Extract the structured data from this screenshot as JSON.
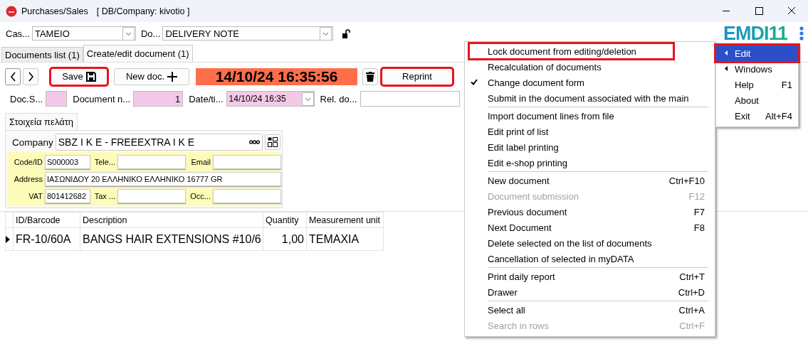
{
  "window": {
    "title": "Purchases/Sales",
    "subtitle": "[ DB/Company: kivotio ]"
  },
  "header": {
    "fields": [
      {
        "label": "Cas...",
        "value": "TAMEIO"
      },
      {
        "label": "Do...",
        "value": "DELIVERY NOTE"
      }
    ],
    "logo": "EMDI11"
  },
  "tabs": [
    {
      "label": "Documents list (1)",
      "selected": false
    },
    {
      "label": "Create/edit document (1)",
      "selected": true
    }
  ],
  "toolbar": {
    "save_button": {
      "label": "Save",
      "highlighted": true
    },
    "new_button": {
      "label": "New doc."
    },
    "clock": "14/10/24 16:35:56",
    "reprint_button": {
      "label": "Reprint",
      "highlighted": true
    }
  },
  "document_fields": [
    {
      "label": "Doc.S...",
      "kind": "field",
      "required": true
    },
    {
      "label": "Document n...",
      "value": "1",
      "kind": "field",
      "required": true
    },
    {
      "label": "Date/ti...",
      "value": "14/10/24 16:35",
      "kind": "combo",
      "required": true
    },
    {
      "label": "Rel. do...",
      "kind": "field",
      "required": false
    }
  ],
  "customer": {
    "tab": "Στοιχεία πελάτη",
    "company_label": "Company",
    "company": "SBZ I K E - FREEEXTRA I K E",
    "rows": [
      [
        {
          "label": "Code/ID",
          "value": "S000003"
        },
        {
          "label": "Tele..."
        },
        {
          "label": "Email"
        }
      ],
      [
        {
          "label": "Address",
          "value": "ΙΑΣΩΝΙΔΟΥ 20 ΕΛΛΗΝΙΚΟ ΕΛΛΗΝΙΚΟ 16777 GR"
        }
      ],
      [
        {
          "label": "VAT",
          "value": "801412682"
        },
        {
          "label": "Tax ..."
        },
        {
          "label": "Occ..."
        }
      ]
    ]
  },
  "table": {
    "columns": [
      "ID/Barcode",
      "Description",
      "Quantity",
      "Measurement unit"
    ],
    "rows": [
      {
        "current": true,
        "cells": [
          "FR-10/60A",
          "BANGS HAIR EXTENSIONS #10/6",
          "1,00",
          "TEMAXIA"
        ]
      }
    ]
  },
  "context_menu": [
    {
      "kind": "item",
      "label": "Lock document from editing/deletion",
      "checked": false,
      "disabled": false,
      "highlighted": true
    },
    {
      "kind": "item",
      "label": "Recalculation of documents",
      "checked": false,
      "disabled": false,
      "highlighted": false
    },
    {
      "kind": "item",
      "label": "Change document form",
      "checked": true,
      "disabled": false,
      "highlighted": false
    },
    {
      "kind": "item",
      "label": "Submit in the document associated with the main",
      "checked": false,
      "disabled": false,
      "highlighted": false
    },
    {
      "kind": "separator"
    },
    {
      "kind": "item",
      "label": "Import document lines from file",
      "checked": false,
      "disabled": false,
      "highlighted": false
    },
    {
      "kind": "item",
      "label": "Edit print of list",
      "checked": false,
      "disabled": false,
      "highlighted": false
    },
    {
      "kind": "item",
      "label": "Edit label printing",
      "checked": false,
      "disabled": false,
      "highlighted": false
    },
    {
      "kind": "item",
      "label": "Edit e-shop printing",
      "checked": false,
      "disabled": false,
      "highlighted": false
    },
    {
      "kind": "separator"
    },
    {
      "kind": "item",
      "label": "New document",
      "shortcut": "Ctrl+F10",
      "checked": false,
      "disabled": false,
      "highlighted": false
    },
    {
      "kind": "item",
      "label": "Document submission",
      "shortcut": "F12",
      "checked": false,
      "disabled": true,
      "highlighted": false
    },
    {
      "kind": "item",
      "label": "Previous document",
      "shortcut": "F7",
      "checked": false,
      "disabled": false,
      "highlighted": false
    },
    {
      "kind": "item",
      "label": "Next Document",
      "shortcut": "F8",
      "checked": false,
      "disabled": false,
      "highlighted": false
    },
    {
      "kind": "item",
      "label": "Delete selected on the list of documents",
      "checked": false,
      "disabled": false,
      "highlighted": false
    },
    {
      "kind": "item",
      "label": "Cancellation of selected in myDATA",
      "checked": false,
      "disabled": false,
      "highlighted": false
    },
    {
      "kind": "separator"
    },
    {
      "kind": "item",
      "label": "Print daily report",
      "shortcut": "Ctrl+T",
      "checked": false,
      "disabled": false,
      "highlighted": false
    },
    {
      "kind": "item",
      "label": "Drawer",
      "shortcut": "Ctrl+D",
      "checked": false,
      "disabled": false,
      "highlighted": false
    },
    {
      "kind": "separator"
    },
    {
      "kind": "item",
      "label": "Select all",
      "shortcut": "Ctrl+A",
      "checked": false,
      "disabled": false,
      "highlighted": false
    },
    {
      "kind": "item",
      "label": "Search in rows",
      "shortcut": "Ctrl+F",
      "checked": false,
      "disabled": true,
      "highlighted": false
    }
  ],
  "main_menu": [
    {
      "label": "Edit",
      "submenu": true,
      "selected": true,
      "highlighted": true
    },
    {
      "label": "Windows",
      "submenu": true,
      "selected": false,
      "highlighted": false
    },
    {
      "label": "Help",
      "shortcut": "F1",
      "submenu": false,
      "selected": false,
      "highlighted": false
    },
    {
      "label": "About",
      "submenu": false,
      "selected": false,
      "highlighted": false
    },
    {
      "label": "Exit",
      "shortcut": "Alt+F4",
      "submenu": false,
      "selected": false,
      "highlighted": false
    }
  ]
}
